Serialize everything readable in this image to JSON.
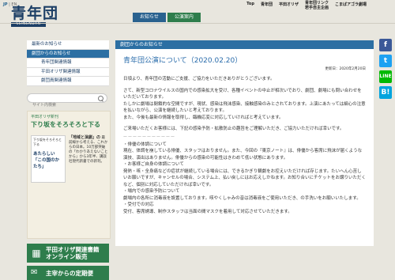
{
  "lang": {
    "jp": "JP",
    "sep": "|",
    "en": "EN"
  },
  "logo": {
    "main": "青年団",
    "sub": "SEINENDAN"
  },
  "nav_tabs": [
    "お知らせ",
    "公演案内"
  ],
  "topnav": [
    "Top",
    "青年団",
    "平田オリザ",
    "青年団リンク",
    "若手自主企画",
    "こまばアゴラ劇場"
  ],
  "sidebar": {
    "items": [
      "最新のお知らせ",
      "劇団からのお知らせ",
      "青年団関連情報",
      "平田オリザ関連情報",
      "劇団員関連情報"
    ],
    "search_placeholder": "サイト内検索"
  },
  "promo": {
    "head": "平田オリザ新刊",
    "title": "下り坂をそろそろと下る",
    "book_top": "下り坂をそろそろと下る",
    "book_big": "あたらしい「この国のかたち」",
    "desc_bold": "「地域と演劇」の",
    "desc": "最前線から考える、これからの日本。10万部突破の「わかりあえないことから」から3年半、講談社現代新書での新刊。"
  },
  "banner1": {
    "icon": "▦",
    "line1": "平田オリザ関連書籍",
    "line2": "オンライン販売"
  },
  "banner2": {
    "icon": "✉",
    "text": "主宰からの定期便"
  },
  "main": {
    "header": "劇団からのお知らせ",
    "title": "青年団公演について（2020.02.20）",
    "date": "更新日：2020年2月20日",
    "paragraphs": [
      "日頃より、青年団の活動にご支援、ご協力をいただきありがとうございます。",
      "さて、新型コロナウイルスの国内での感染拡大を受け、各種イベントの中止が相次いでおり、劇団、劇場にも問い合わせをいただいております。",
      "たしかに劇場は閉鎖的な空間ですが、現状、感染は飛沫感染、接触感染のみとされております。上演にあたっては細心の注意を払いながら、公演を継続したいと考えております。",
      "また、今後も最新の情報を取得し、臨機応変に対応していければと考えています。",
      "ご来場いただくお客様には、下記の感染予防・拡散防止の趣旨をご理解いただき、ご協力いただければ幸いです。"
    ],
    "divider": "ーーーーーーーーーーー",
    "sections": [
      {
        "head": "・俳優の体調について",
        "body": "現在、体調を崩している俳優、スタッフはおりません。また、今回の『東京ノート』は、俳優から客席に飛沫が届くような演技、演出はありません。俳優からの感染の可能性はきわめて低い状態にあります。"
      },
      {
        "head": "・お客様ご自身の体調について",
        "body": "発熱・咳・全身痛などの症状が継続している場合には、できるかぎり観劇をお控えいただければ存じます。たいへん心苦しいお願いですが、キャンセルの場合、システム上、払い戻しにはお応えしかねます。お知り合いにチケットをお譲りいただくなど、個別に対応していただければ幸いです。"
      },
      {
        "head": "・場内での感染予防について",
        "body": "劇場内の各所に消毒液を設置しております。咳やくしゃみの音は消毒液をご使用いただき、の手洗いをお願いいたします。"
      },
      {
        "head": "・受付での対応",
        "body": "受付、客席誘導、制作スタッフは当面の間マスクを着用して対応させていただきます。"
      }
    ]
  },
  "share": {
    "fb": "f",
    "tw": "t",
    "line": "LINE",
    "bk": "B!"
  }
}
